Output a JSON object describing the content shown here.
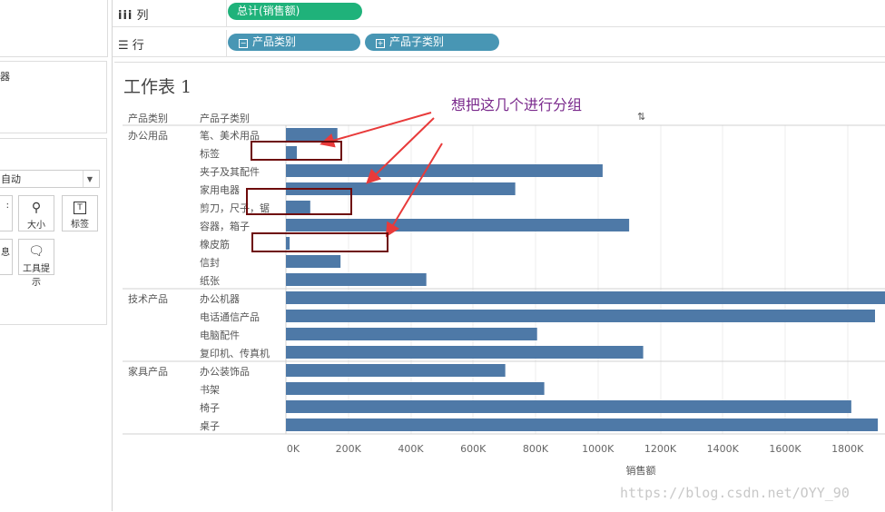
{
  "left": {
    "card1_label": "器",
    "dropdown_value": "自动",
    "mark_buttons": [
      {
        "label": "大小",
        "icon": "size-icon"
      },
      {
        "label": "标签",
        "icon": "label-icon"
      },
      {
        "label": "工具提示",
        "icon": "tooltip-icon"
      }
    ],
    "cut_button_left_top": "",
    "cut_button_left_bottom": "息"
  },
  "shelves": {
    "columns_label": "列",
    "rows_label": "行",
    "columns_pill": "总计(销售额)",
    "row_pills": [
      {
        "label": "产品类别",
        "sign": "⊟"
      },
      {
        "label": "产品子类别",
        "sign": "⊞"
      }
    ]
  },
  "view": {
    "sheet_title": "工作表 1",
    "header_category": "产品类别",
    "header_subcategory": "产品子类别",
    "axis_title": "销售额",
    "annotation": "想把这几个进行分组",
    "watermark": "https://blog.csdn.net/OYY_90"
  },
  "chart_data": {
    "type": "bar",
    "orientation": "horizontal",
    "xlabel": "销售额",
    "xlim": [
      0,
      1900000
    ],
    "xticks": [
      0,
      200000,
      400000,
      600000,
      800000,
      1000000,
      1200000,
      1400000,
      1600000,
      1800000
    ],
    "xtick_labels": [
      "0K",
      "200K",
      "400K",
      "600K",
      "800K",
      "1000K",
      "1200K",
      "1400K",
      "1600K",
      "1800K"
    ],
    "groups": [
      {
        "name": "办公用品",
        "items": [
          {
            "label": "笔、美术用品",
            "value": 165000
          },
          {
            "label": "标签",
            "value": 35000
          },
          {
            "label": "夹子及其配件",
            "value": 1015000
          },
          {
            "label": "家用电器",
            "value": 735000
          },
          {
            "label": "剪刀，尺子，锯",
            "value": 78000
          },
          {
            "label": "容器，箱子",
            "value": 1100000
          },
          {
            "label": "橡皮筋",
            "value": 12000
          },
          {
            "label": "信封",
            "value": 175000
          },
          {
            "label": "纸张",
            "value": 450000
          }
        ]
      },
      {
        "name": "技术产品",
        "items": [
          {
            "label": "办公机器",
            "value": 1920000
          },
          {
            "label": "电话通信产品",
            "value": 1888000
          },
          {
            "label": "电脑配件",
            "value": 805000
          },
          {
            "label": "复印机、传真机",
            "value": 1145000
          }
        ]
      },
      {
        "name": "家具产品",
        "items": [
          {
            "label": "办公装饰品",
            "value": 703000
          },
          {
            "label": "书架",
            "value": 828000
          },
          {
            "label": "椅子",
            "value": 1812000
          },
          {
            "label": "桌子",
            "value": 1897000
          }
        ]
      }
    ]
  }
}
